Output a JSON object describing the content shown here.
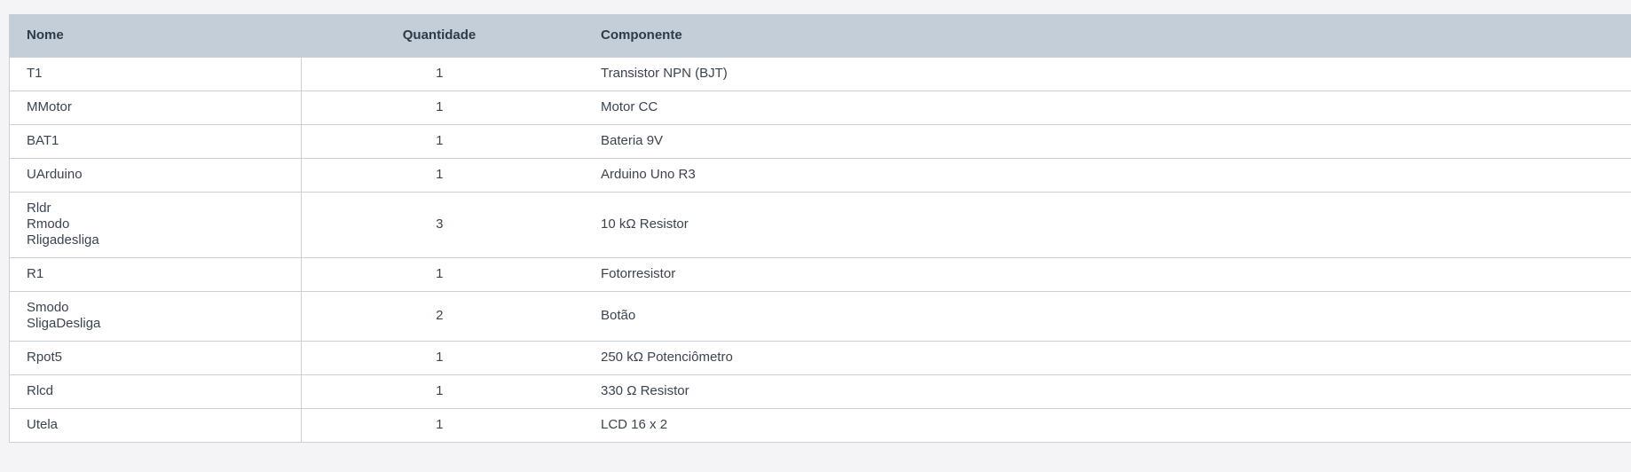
{
  "table": {
    "headers": {
      "nome": "Nome",
      "quantidade": "Quantidade",
      "componente": "Componente"
    },
    "rows": [
      {
        "nome": [
          "T1"
        ],
        "quantidade": "1",
        "componente": "Transistor NPN (BJT)"
      },
      {
        "nome": [
          "MMotor"
        ],
        "quantidade": "1",
        "componente": "Motor CC"
      },
      {
        "nome": [
          "BAT1"
        ],
        "quantidade": "1",
        "componente": "Bateria 9V"
      },
      {
        "nome": [
          "UArduino"
        ],
        "quantidade": "1",
        "componente": "Arduino Uno R3"
      },
      {
        "nome": [
          "Rldr",
          "Rmodo",
          "Rligadesliga"
        ],
        "quantidade": "3",
        "componente": "10 kΩ Resistor"
      },
      {
        "nome": [
          "R1"
        ],
        "quantidade": "1",
        "componente": "Fotorresistor"
      },
      {
        "nome": [
          "Smodo",
          "SligaDesliga"
        ],
        "quantidade": "2",
        "componente": "Botão"
      },
      {
        "nome": [
          "Rpot5"
        ],
        "quantidade": "1",
        "componente": "250 kΩ Potenciômetro"
      },
      {
        "nome": [
          "Rlcd"
        ],
        "quantidade": "1",
        "componente": "330 Ω Resistor"
      },
      {
        "nome": [
          "Utela"
        ],
        "quantidade": "1",
        "componente": "LCD 16 x 2"
      }
    ]
  }
}
